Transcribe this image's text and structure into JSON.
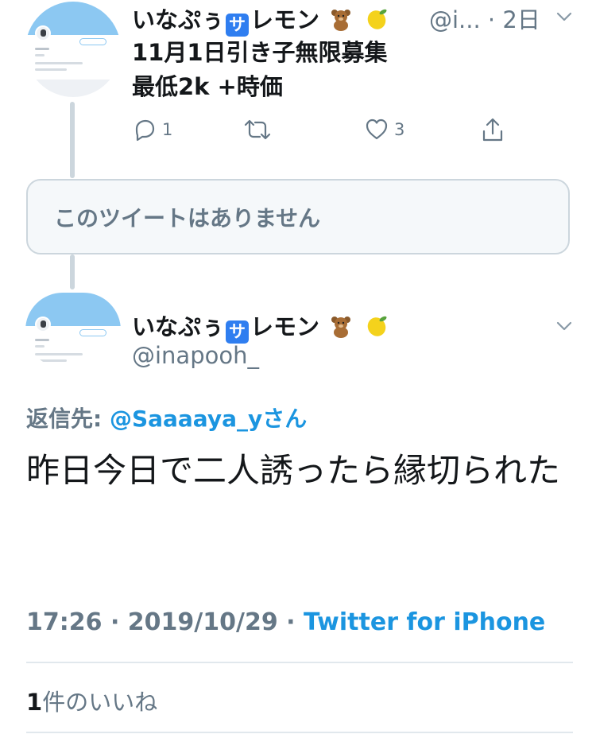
{
  "parent_tweet": {
    "display_name": "いなぷぅ",
    "display_name_badge": "サ",
    "display_name_suffix": "レモン",
    "handle_truncated": "@i...",
    "time_ago": "2日",
    "text_lines": [
      "11月1日引き子無限募集",
      "最低2k +時価"
    ],
    "reply_count": "1",
    "like_count": "3",
    "icons": [
      "reply-icon",
      "retweet-icon",
      "like-icon",
      "share-icon",
      "chevron-down-icon"
    ]
  },
  "deleted_tweet": {
    "text": "このツイートはありません"
  },
  "main_tweet": {
    "display_name": "いなぷぅ",
    "display_name_badge": "サ",
    "display_name_suffix": "レモン",
    "handle": "@inapooh_",
    "reply_prefix": "返信先: ",
    "reply_to": "@Saaaaya_yさん",
    "text": "昨日今日で二人誘ったら縁切られた",
    "time": "17:26",
    "date": "2019/10/29",
    "separator": " · ",
    "source": "Twitter for iPhone",
    "likes_count": "1",
    "likes_label": "件のいいね"
  },
  "colors": {
    "primary_text": "#14171a",
    "secondary_text": "#657786",
    "link_blue": "#1b95e0",
    "border": "#ccd6dd"
  }
}
